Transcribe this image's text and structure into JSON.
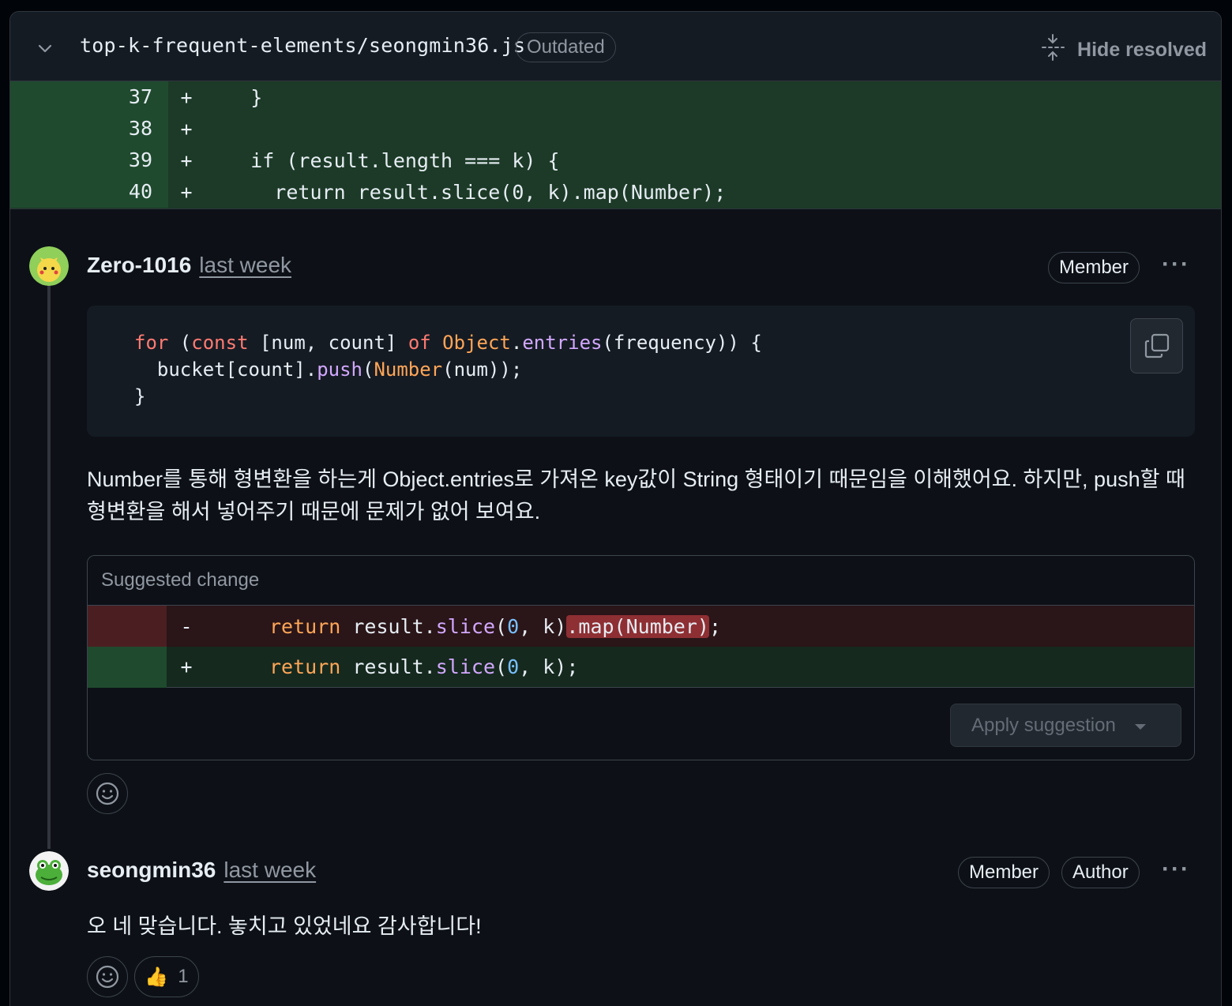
{
  "file": {
    "path": "top-k-frequent-elements/seongmin36.js",
    "status_badge": "Outdated",
    "hide_resolved_label": "Hide resolved"
  },
  "diff_lines": [
    {
      "num": "37",
      "sign": "+",
      "code": "    }"
    },
    {
      "num": "38",
      "sign": "+",
      "code": ""
    },
    {
      "num": "39",
      "sign": "+",
      "code": "    if (result.length === k) {"
    },
    {
      "num": "40",
      "sign": "+",
      "code": "      return result.slice(0, k).map(Number);"
    }
  ],
  "comments": [
    {
      "author": "Zero-1016",
      "time": "last week",
      "badges": [
        "Member"
      ],
      "more": "···",
      "snippet": {
        "line1": {
          "for": "for",
          "open": " (",
          "const": "const",
          "mid": " [num, count] ",
          "of": "of",
          "sp": " ",
          "obj": "Object",
          "dot": ".",
          "entries": "entries",
          "rest": "(frequency)) {"
        },
        "line2": {
          "pre": "  bucket[count].",
          "push": "push",
          "p": "(",
          "number": "Number",
          "rest": "(num));"
        },
        "line3": "}"
      },
      "body": "Number를 통해 형변환을 하는게 Object.entries로 가져온 key값이 String 형태이기 때문임을 이해했어요. 하지만, push할 때 형변환을 해서 넣어주기 때문에 문제가 없어 보여요.",
      "suggestion": {
        "title": "Suggested change",
        "del_sign": "-",
        "add_sign": "+",
        "del": {
          "ret": "return",
          "a": " result.",
          "slice": "slice",
          "b": "(",
          "zero": "0",
          "c": ", k)",
          "hl": ".map(Number)",
          "end": ";"
        },
        "add": {
          "ret": "return",
          "a": " result.",
          "slice": "slice",
          "b": "(",
          "zero": "0",
          "c": ", k);"
        },
        "apply_label": "Apply suggestion"
      }
    },
    {
      "author": "seongmin36",
      "time": "last week",
      "badges": [
        "Member",
        "Author"
      ],
      "more": "···",
      "body": "오 네 맞습니다. 놓치고 있었네요 감사합니다!",
      "reactions": [
        {
          "emoji": "👍",
          "count": "1"
        }
      ]
    }
  ],
  "colors": {
    "bg": "#0d1117",
    "added_line": "#1c3a27",
    "deleted_line": "#2a1518",
    "border": "#30363d"
  }
}
